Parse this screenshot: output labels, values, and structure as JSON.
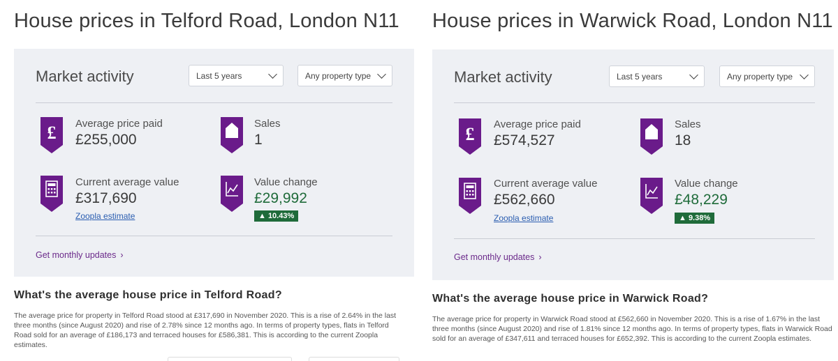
{
  "left": {
    "title": "House prices in Telford Road, London N11",
    "card": {
      "title": "Market activity",
      "period_select": "Last 5 years",
      "property_select": "Any property type",
      "avg_price_label": "Average price paid",
      "avg_price_value": "£255,000",
      "sales_label": "Sales",
      "sales_value": "1",
      "current_label": "Current average value",
      "current_value": "£317,690",
      "estimate_link": "Zoopla estimate",
      "change_label": "Value change",
      "change_value": "£29,992",
      "change_badge": "▲ 10.43%",
      "updates_link": "Get monthly updates",
      "updates_arrow": "›"
    },
    "heading": "What's the average house price in Telford Road?",
    "body": "The average price for property in Telford Road stood at £317,690 in November 2020. This is a rise of 2.64% in the last three months (since August 2020) and rise of 2.78% since 12 months ago. In terms of property types, flats in Telford Road sold for an average of £186,173 and terraced houses for £586,381. This is according to the current Zoopla estimates."
  },
  "right": {
    "title": "House prices in Warwick Road, London N11",
    "card": {
      "title": "Market activity",
      "period_select": "Last 5 years",
      "property_select": "Any property type",
      "avg_price_label": "Average price paid",
      "avg_price_value": "£574,527",
      "sales_label": "Sales",
      "sales_value": "18",
      "current_label": "Current average value",
      "current_value": "£562,660",
      "estimate_link": "Zoopla estimate",
      "change_label": "Value change",
      "change_value": "£48,229",
      "change_badge": "▲ 9.38%",
      "updates_link": "Get monthly updates",
      "updates_arrow": "›"
    },
    "heading": "What's the average house price in Warwick Road?",
    "body": "The average price for property in Warwick Road stood at £562,660 in November 2020. This is a rise of 1.67% in the last three months (since August 2020) and rise of 1.81% since 12 months ago. In terms of property types, flats in Warwick Road sold for an average of £347,611 and terraced houses for £652,392. This is according to the current Zoopla estimates."
  },
  "colors": {
    "brand_purple": "#6a1b8a",
    "positive_green": "#1f6b3a",
    "card_background": "#eef0f4",
    "link_blue": "#2a5db0"
  },
  "icons": [
    "pound-icon",
    "house-icon",
    "calculator-icon",
    "chart-icon"
  ]
}
